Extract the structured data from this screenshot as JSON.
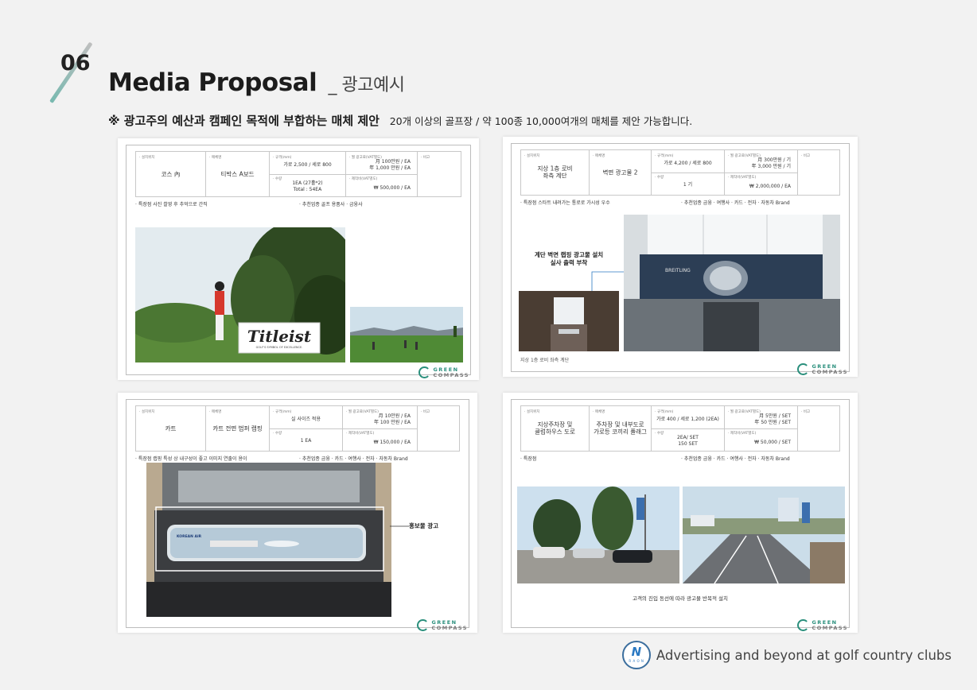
{
  "header": {
    "section_number": "06",
    "title": "Media Proposal",
    "title_suffix": "_ 광고예시",
    "subtitle_bold": "※ 광고주의 예산과 캠페인 목적에 부합하는 매체 제안",
    "subtitle_desc": "20개 이상의 골프장 / 약 100종 10,000여개의 매체를 제안 가능합니다."
  },
  "labels": {
    "location": "· 설치위치",
    "media": "· 매체명",
    "size": "· 규격(mm)",
    "qty": "· 수량",
    "monthly_fee": "· 월 광고료(VAT별도)",
    "production_fee": "· 제작비(VAT별도)",
    "note": "· 비고"
  },
  "cards": [
    {
      "location": "코스 內",
      "media": "티박스 A보드",
      "size": "가로 2,500 / 세로 800",
      "qty": "1EA (27홀*2)\nTotal : 54EA",
      "monthly_fee": "月 100만원 / EA\n年 1,000 만원 / EA",
      "production_fee": "₩ 500,000 / EA",
      "features": "· 특장점    사진 촬영 후 추억으로 간직",
      "industries": "· 추천업종    골프 용품사 · 금융사"
    },
    {
      "location": "지상 1층 로비\n좌측 계단",
      "media": "벽면 광고물 2",
      "size": "가로 4,200 / 세로 800",
      "qty": "1 기",
      "monthly_fee": "月 300만원 / 기\n年 3,000 만원 / 기",
      "production_fee": "₩ 2,000,000 / EA",
      "features": "· 특장점    스타트 내려가는 통로로 가시성 우수",
      "industries": "· 추천업종    금융 · 여행사 · 카드 · 전자 · 자동차 Brand",
      "callout": "계단 벽면 랩핑 광고물 설치\n실사 출력 부착",
      "caption": "지상 1층 로비 좌측 계단"
    },
    {
      "location": "카트",
      "media": "카트 전면 범퍼 랩핑",
      "size": "실 사이즈 적용",
      "qty": "1 EA",
      "monthly_fee": "月 10만원 / EA\n年 100 만원 / EA",
      "production_fee": "₩ 150,000 / EA",
      "features": "· 특장점    랩핑 특성 상 내구성이 좋고 이미지 연출이 용이",
      "industries": "· 추천업종    금융 · 카드 · 여행사 · 전자 · 자동차 Brand",
      "callout": "홍보물 광고",
      "ad_text": "KOREAN AIR"
    },
    {
      "location": "지상주차장 및\n클럽하우스 도로",
      "media": "주차장 및 내부도로\n가로등 코끼리 플래그",
      "size": "가로 400 / 세로 1,200 (2EA)",
      "qty": "2EA/ SET\n150 SET",
      "monthly_fee": "月 5만원 / SET\n年 50 만원 / SET",
      "production_fee": "₩ 50,000 / SET",
      "features": "· 특장점",
      "industries": "· 추천업종    금융 · 카드 · 여행사 · 전자 · 자동차 Brand",
      "caption": "고객의 진입 동선에 따라 광고물 반복적 설치"
    }
  ],
  "brand": {
    "word1": "GREEN",
    "word2": "COMPASS",
    "ad_brand_1": "Titleist",
    "ad_brand_1_tagline": "GOLF'S SYMBOL OF EXCELLENCE.",
    "ad_brand_2": "BREITLING"
  },
  "footer": {
    "badge_letter": "N",
    "badge_text": "R A O N",
    "slogan": "Advertising and beyond at golf country clubs"
  }
}
